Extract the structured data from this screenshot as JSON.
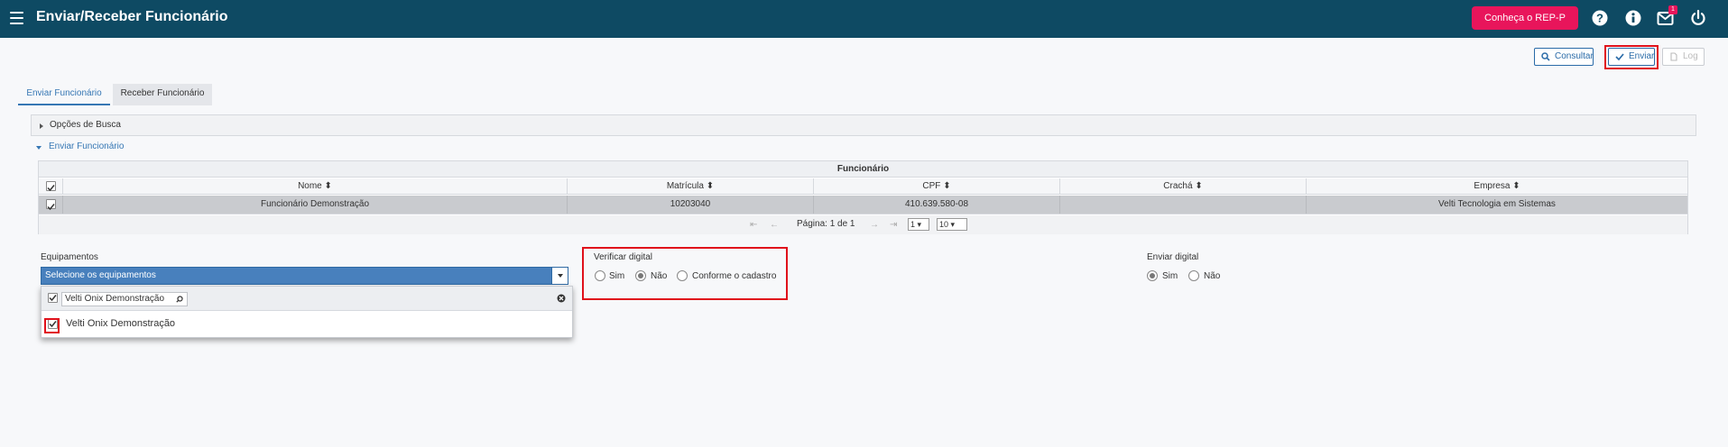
{
  "header": {
    "title": "Enviar/Receber Funcionário",
    "rep_button_label": "Conheça o REP-P",
    "notification_count": "1"
  },
  "toolbar": {
    "consultar_label": "Consultar",
    "enviar_label": "Enviar",
    "log_label": "Log"
  },
  "tabs": [
    {
      "label": "Enviar Funcionário",
      "active": true
    },
    {
      "label": "Receber Funcionário",
      "active": false
    }
  ],
  "search_panel": {
    "label": "Opções de Busca"
  },
  "section": {
    "title": "Enviar Funcionário"
  },
  "grid": {
    "caption": "Funcionário",
    "columns": [
      "Nome",
      "Matrícula",
      "CPF",
      "Crachá",
      "Empresa"
    ],
    "rows": [
      {
        "selected": true,
        "cells": [
          "Funcionário Demonstração",
          "10203040",
          "410.639.580-08",
          "",
          "Velti Tecnologia em Sistemas"
        ]
      }
    ],
    "pager": {
      "page_text": "Página: 1 de 1",
      "page_select": "1",
      "page_size": "10"
    }
  },
  "equipamentos": {
    "label": "Equipamentos",
    "select_placeholder": "Selecione os equipamentos",
    "filter_value": "Velti Onix Demonstração",
    "options": [
      {
        "label": "Velti Onix Demonstração",
        "checked": true
      }
    ]
  },
  "verificar_digital": {
    "label": "Verificar digital",
    "options": [
      {
        "label": "Sim",
        "checked": false
      },
      {
        "label": "Não",
        "checked": true
      },
      {
        "label": "Conforme o cadastro",
        "checked": false
      }
    ]
  },
  "enviar_digital": {
    "label": "Enviar digital",
    "options": [
      {
        "label": "Sim",
        "checked": true
      },
      {
        "label": "Não",
        "checked": false
      }
    ]
  },
  "colors": {
    "topbar": "#0e4a63",
    "accent": "#3677b4",
    "rep_button": "#e8155b",
    "highlight_outline": "#e0111b"
  }
}
